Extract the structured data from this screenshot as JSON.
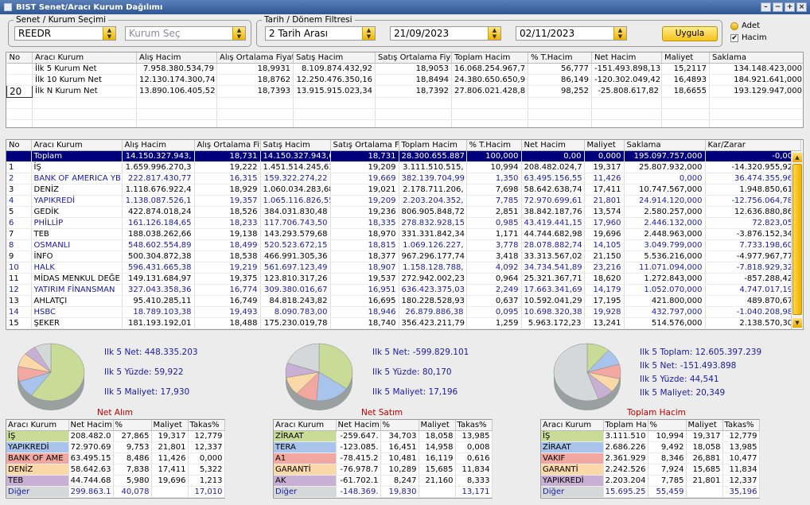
{
  "window": {
    "title": "BIST Senet/Aracı Kurum Dağılımı"
  },
  "filters": {
    "senet_legend": "Senet / Kurum Seçimi",
    "symbol": "REEDR",
    "kurum_placeholder": "Kurum Seç",
    "date_legend": "Tarih / Dönem Filtresi",
    "mode": "2 Tarih Arası",
    "start": "21/09/2023",
    "end": "02/11/2023",
    "apply": "Uygula",
    "opt_adet": "Adet",
    "opt_hacim": "Hacim"
  },
  "summary": {
    "columns": [
      "No",
      "Aracı Kurum",
      "Alış Hacim",
      "Alış Ortalama Fiyat",
      "Satış Hacim",
      "Satış Ortalama Fiyat",
      "Toplam Hacim",
      "% T.Hacim",
      "Net Hacim",
      "Maliyet",
      "Saklama"
    ],
    "rows": [
      [
        "",
        "İlk 5 Kurum Net",
        "7.958.380.534,79",
        "18,9931",
        "8.109.874.432,92",
        "18,9053",
        "16.068.254.967,7",
        "56,777",
        "-151.493.898,13",
        "15,2117",
        "134.148.423,000"
      ],
      [
        "",
        "İlk 10 Kurum Net",
        "12.130.174.300,74",
        "18,8762",
        "12.250.476.350,16",
        "18,8494",
        "24.380.650.650,9",
        "86,149",
        "-120.302.049,42",
        "16,4893",
        "184.921.641,000"
      ],
      [
        "20",
        "İlk N Kurum Net",
        "13.890.106.405,52",
        "18,7393",
        "13.915.915.023,34",
        "18,7392",
        "27.806.021.428,8",
        "98,252",
        "-25.808.617,82",
        "18,6655",
        "193.129.947,000"
      ]
    ]
  },
  "main": {
    "columns": [
      "No",
      "Aracı Kurum",
      "Alış Hacim",
      "Alış Ortalama Fiy",
      "Satış Hacim",
      "Satış Ortalama Fi",
      "Toplam Hacim",
      "% T.Hacim",
      "Net Hacim",
      "Maliyet",
      "Saklama",
      "Kar/Zarar"
    ],
    "rows": [
      [
        "",
        "Toplam",
        "14.150.327.943,",
        "18,731",
        "14.150.327.943,6",
        "18,731",
        "28.300.655.887",
        "100,000",
        "0,00",
        "0,000",
        "195.097.757,000",
        "-0,000"
      ],
      [
        "1",
        "İŞ",
        "1.659.996.270,3",
        "19,222",
        "1.451.514.245,63",
        "19,209",
        "3.111.510.515,",
        "10,994",
        "208.482.024,7",
        "19,317",
        "25.807.932,000",
        "-14.320.955,920"
      ],
      [
        "2",
        "BANK OF AMERICA YB",
        "222.817.430,77",
        "16,315",
        "159.322.274,22",
        "19,669",
        "382.139.704,99",
        "1,350",
        "63.495.156,55",
        "11,426",
        "0,000",
        "36.474.355,960"
      ],
      [
        "3",
        "DENİZ",
        "1.118.676.922,4",
        "18,929",
        "1.060.034.283,68",
        "19,021",
        "2.178.711.206,",
        "7,698",
        "58.642.638,74",
        "17,411",
        "10.747.567,000",
        "1.948.850,610"
      ],
      [
        "4",
        "YAPIKREDİ",
        "1.138.087.526,1",
        "19,357",
        "1.065.116.826,55",
        "19,209",
        "2.203.204.352,",
        "7,785",
        "72.970.699,61",
        "21,801",
        "24.914.120,000",
        "-12.756.064,780"
      ],
      [
        "5",
        "GEDİK",
        "422.874.018,24",
        "18,526",
        "384.031.830,48",
        "19,236",
        "806.905.848,72",
        "2,851",
        "38.842.187,76",
        "13,574",
        "2.580.257,000",
        "12.636.880,860"
      ],
      [
        "6",
        "PHİLLİP",
        "161.126.184,65",
        "18,233",
        "117.706.743,50",
        "18,335",
        "278.832.928,15",
        "0,985",
        "43.419.441,15",
        "17,960",
        "2.446.132,000",
        "72.823,050"
      ],
      [
        "7",
        "TEB",
        "188.038.262,66",
        "19,138",
        "143.293.579,68",
        "18,970",
        "331.331.842,34",
        "1,171",
        "44.744.682,98",
        "19,696",
        "2.448.963,000",
        "-3.876.152,340"
      ],
      [
        "8",
        "OSMANLI",
        "548.602.554,89",
        "18,499",
        "520.523.672,15",
        "18,815",
        "1.069.126.227,",
        "3,778",
        "28.078.882,74",
        "14,105",
        "3.049.799,000",
        "7.733.198,600"
      ],
      [
        "9",
        "İNFO",
        "500.304.872,38",
        "18,538",
        "466.991.305,36",
        "18,377",
        "967.296.177,74",
        "3,418",
        "33.313.567,02",
        "21,150",
        "5.536.216,000",
        "-4.977.967,770"
      ],
      [
        "10",
        "HALK",
        "596.431.665,38",
        "19,219",
        "561.697.123,49",
        "18,907",
        "1.158.128.788,",
        "4,092",
        "34.734.541,89",
        "23,216",
        "11.071.094,000",
        "-7.818.929,320"
      ],
      [
        "11",
        "MİDAS MENKUL DEĞE",
        "149.131.684,97",
        "19,375",
        "123.810.317,26",
        "19,537",
        "272.942.002,23",
        "0,964",
        "25.321.367,71",
        "18,620",
        "1.272.843,000",
        "-857.288,420"
      ],
      [
        "12",
        "YATIRIM FİNANSMAN",
        "327.043.358,36",
        "16,774",
        "309.380.016,67",
        "16,951",
        "636.423.375,03",
        "2,249",
        "17.663.341,69",
        "14,179",
        "1.052.070,000",
        "4.747.017,190"
      ],
      [
        "13",
        "AHLATÇI",
        "95.410.285,11",
        "16,749",
        "84.818.243,82",
        "16,695",
        "180.228.528,93",
        "0,637",
        "10.592.041,29",
        "17,195",
        "421.800,000",
        "489.870,670"
      ],
      [
        "14",
        "HSBC",
        "18.789.103,38",
        "19,493",
        "8.090.783,00",
        "18,946",
        "26.879.886,38",
        "0,095",
        "10.698.320,38",
        "19,928",
        "432.797,000",
        "-1.040.208,980"
      ],
      [
        "15",
        "ŞEKER",
        "181.193.192,01",
        "18,488",
        "175.230.019,78",
        "18,740",
        "356.423.211,79",
        "1,259",
        "5.963.172,23",
        "13,241",
        "514.576,000",
        "2.138.570,300"
      ]
    ]
  },
  "panels": [
    {
      "title": "Net Alım",
      "info": [
        "Ilk 5 Net: 448.335.203",
        "Ilk 5 Yüzde: 59,922",
        "Ilk 5 Maliyet: 17,930"
      ],
      "columns": [
        "Aracı Kurum",
        "Net Hacim",
        "%",
        "Maliyet",
        "Takas%"
      ],
      "rows": [
        [
          "İŞ",
          "208.482.0",
          "27,865",
          "19,317",
          "12,779"
        ],
        [
          "YAPIKREDİ",
          "72.970.69",
          "9,753",
          "21,801",
          "12,337"
        ],
        [
          "BANK OF AME",
          "63.495.15",
          "8,486",
          "11,426",
          "0,000"
        ],
        [
          "DENİZ",
          "58.642.63",
          "7,838",
          "17,411",
          "5,322"
        ],
        [
          "TEB",
          "44.744.68",
          "5,980",
          "19,696",
          "1,213"
        ],
        [
          "Diğer",
          "299.863.1",
          "40,078",
          "",
          "17,010"
        ]
      ],
      "pie": [
        59.9,
        9.8,
        8.5,
        7.8,
        6.0,
        8.0
      ],
      "colors": [
        "#c8dc98",
        "#a8c4ec",
        "#f2a8a0",
        "#fbd8a8",
        "#c8b0d4",
        "#d4d8d8"
      ]
    },
    {
      "title": "Net Satım",
      "info": [
        "Ilk 5 Net: -599.829.101",
        "Ilk 5 Yüzde: 80,170",
        "Ilk 5 Maliyet: 17,196"
      ],
      "columns": [
        "Aracı Kurum",
        "Net Hacim",
        "%",
        "Maliyet",
        "Takas%"
      ],
      "rows": [
        [
          "ZİRAAT",
          "-259.647.",
          "34,703",
          "18,058",
          "13,985"
        ],
        [
          "TERA",
          "-123.085.",
          "16,451",
          "14,958",
          "0,008"
        ],
        [
          "A1",
          "-78.415.2",
          "10,481",
          "16,119",
          "0,616"
        ],
        [
          "GARANTİ",
          "-76.978.7",
          "10,289",
          "15,685",
          "11,834"
        ],
        [
          "AK",
          "-61.702.1",
          "8,247",
          "21,160",
          "8,333"
        ],
        [
          "Diğer",
          "-148.369.",
          "19,830",
          "",
          "13,171"
        ]
      ],
      "pie": [
        34.7,
        16.5,
        10.5,
        10.3,
        8.2,
        19.8
      ],
      "colors": [
        "#c8dc98",
        "#a8c4ec",
        "#f2a8a0",
        "#fbd8a8",
        "#c8b0d4",
        "#d4d8d8"
      ]
    },
    {
      "title": "Toplam Hacim",
      "info": [
        "Ilk 5 Toplam: 12.605.397.239",
        "Ilk 5 Net: -151.493.898",
        "Ilk 5 Yüzde: 44,541",
        "Ilk 5 Maliyet: 20,349"
      ],
      "columns": [
        "Aracı Kurum",
        "Toplam Ha",
        "%",
        "Maliyet",
        "Takas%"
      ],
      "rows": [
        [
          "İŞ",
          "3.111.510",
          "10,994",
          "19,317",
          "12,779"
        ],
        [
          "ZİRAAT",
          "2.686.226",
          "9,492",
          "18,058",
          "13,985"
        ],
        [
          "VAKIF",
          "2.361.929",
          "8,346",
          "26,881",
          "10,477"
        ],
        [
          "GARANTİ",
          "2.242.526",
          "7,924",
          "15,685",
          "11,834"
        ],
        [
          "YAPIKREDİ",
          "2.203.204",
          "7,785",
          "21,801",
          "12,337"
        ],
        [
          "Diğer",
          "15.695.25",
          "55,459",
          "",
          "35,196"
        ]
      ],
      "pie": [
        11.0,
        9.5,
        8.3,
        7.9,
        7.8,
        55.5
      ],
      "colors": [
        "#c8dc98",
        "#a8c4ec",
        "#f2a8a0",
        "#fbd8a8",
        "#c8b0d4",
        "#d4d8d8"
      ]
    }
  ]
}
